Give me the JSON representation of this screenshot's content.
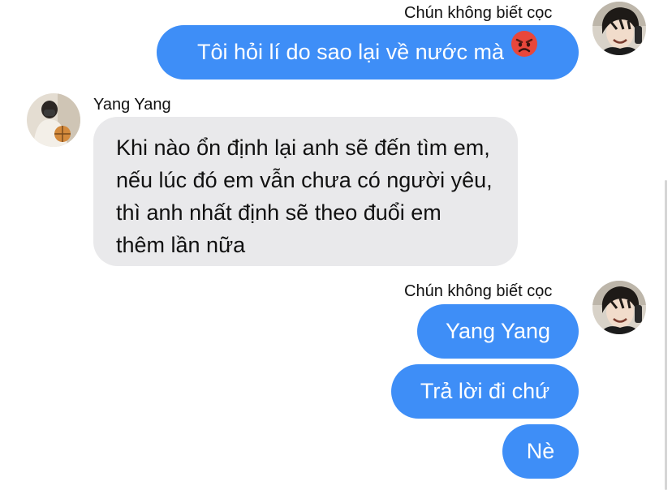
{
  "conversation": {
    "groups": [
      {
        "side": "outgoing",
        "sender": "Chún không biết cọc",
        "messages": [
          {
            "text": "Tôi hỏi lí do sao lại về nước mà",
            "emoji": "angry-face-icon"
          }
        ]
      },
      {
        "side": "incoming",
        "sender": "Yang Yang",
        "messages": [
          {
            "text": "Khi nào ổn định lại anh sẽ đến tìm em, nếu lúc đó em vẫn chưa có người yêu, thì anh nhất định sẽ theo đuổi em thêm lần nữa"
          }
        ]
      },
      {
        "side": "outgoing",
        "sender": "Chún không biết cọc",
        "messages": [
          {
            "text": "Yang Yang"
          },
          {
            "text": "Trả lời đi chứ"
          },
          {
            "text": "Nè"
          }
        ]
      }
    ]
  },
  "colors": {
    "outgoing_bubble": "#3e8ef7",
    "incoming_bubble": "#e9e9eb",
    "background": "#ffffff"
  }
}
